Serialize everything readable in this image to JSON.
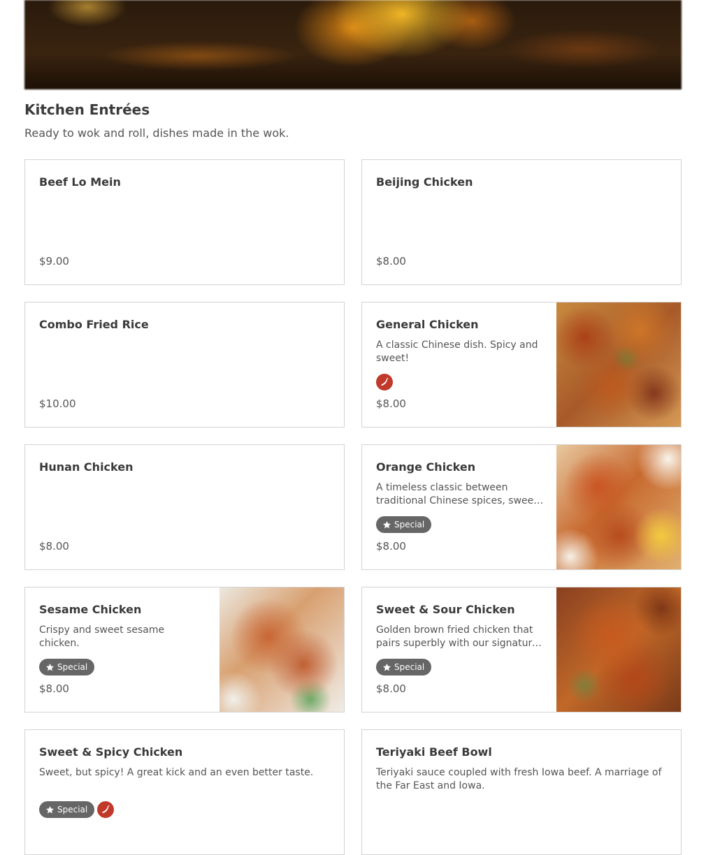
{
  "section": {
    "title": "Kitchen Entrées",
    "subtitle": "Ready to wok and roll, dishes made in the wok."
  },
  "badges": {
    "special": "Special"
  },
  "items": [
    {
      "name": "Beef Lo Mein",
      "description": "",
      "price": "$9.00",
      "special": false,
      "spicy": false,
      "image": false
    },
    {
      "name": "Beijing Chicken",
      "description": "",
      "price": "$8.00",
      "special": false,
      "spicy": false,
      "image": false
    },
    {
      "name": "Combo Fried Rice",
      "description": "",
      "price": "$10.00",
      "special": false,
      "spicy": false,
      "image": false
    },
    {
      "name": "General Chicken",
      "description": "A classic Chinese dish. Spicy and sweet!",
      "price": "$8.00",
      "special": false,
      "spicy": true,
      "image": true
    },
    {
      "name": "Hunan Chicken",
      "description": "",
      "price": "$8.00",
      "special": false,
      "spicy": false,
      "image": false
    },
    {
      "name": "Orange Chicken",
      "description": "A timeless classic between traditional Chinese spices, sweet orange glaze and crispy chicken.",
      "price": "$8.00",
      "special": true,
      "spicy": false,
      "image": true
    },
    {
      "name": "Sesame Chicken",
      "description": "Crispy and sweet sesame chicken.",
      "price": "$8.00",
      "special": true,
      "spicy": false,
      "image": true
    },
    {
      "name": "Sweet & Sour Chicken",
      "description": "Golden brown fried chicken that pairs superbly with our signature sweet and sour sauce.",
      "price": "$8.00",
      "special": true,
      "spicy": false,
      "image": true
    },
    {
      "name": "Sweet & Spicy Chicken",
      "description": "Sweet, but spicy! A great kick and an even better taste.",
      "price": "",
      "special": true,
      "spicy": true,
      "image": false
    },
    {
      "name": "Teriyaki Beef Bowl",
      "description": "Teriyaki sauce coupled with fresh Iowa beef. A marriage of the Far East and Iowa.",
      "price": "",
      "special": false,
      "spicy": false,
      "image": false
    }
  ]
}
